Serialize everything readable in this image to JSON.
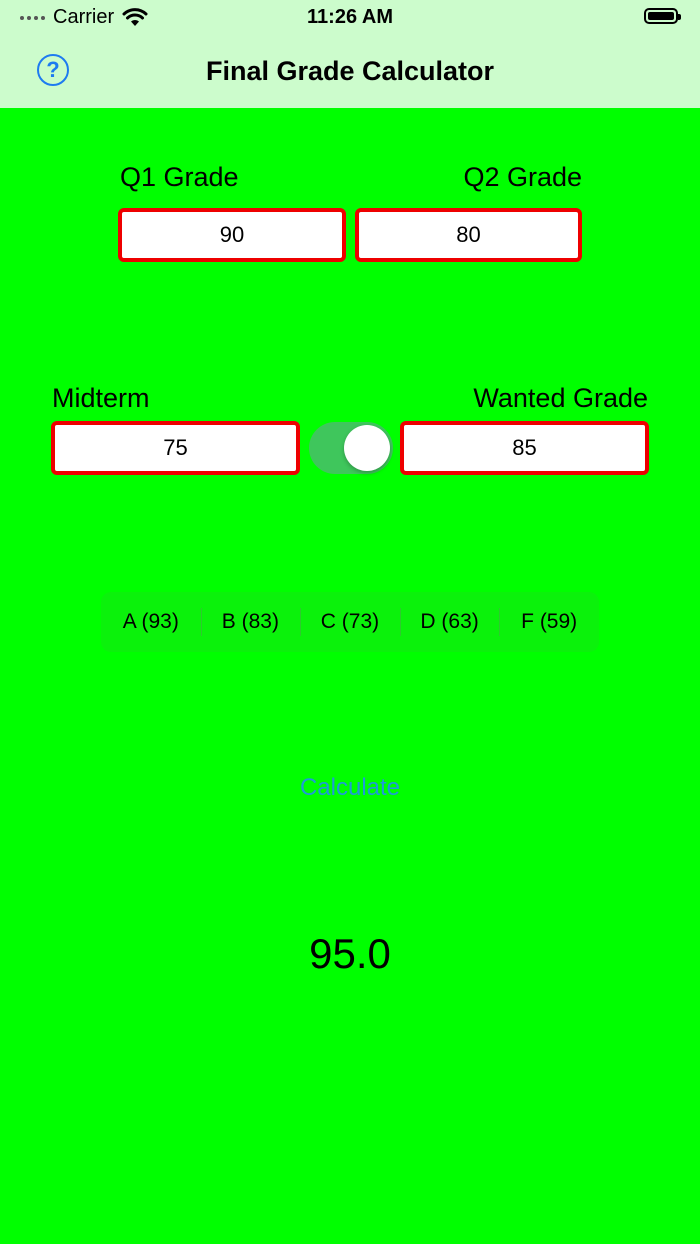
{
  "status_bar": {
    "carrier": "Carrier",
    "time": "11:26 AM"
  },
  "nav": {
    "title": "Final Grade Calculator",
    "help_label": "?"
  },
  "form": {
    "q1_label": "Q1 Grade",
    "q1_value": "90",
    "q2_label": "Q2 Grade",
    "q2_value": "80",
    "midterm_label": "Midterm",
    "midterm_value": "75",
    "wanted_label": "Wanted Grade",
    "wanted_value": "85",
    "toggle_on": true
  },
  "segments": [
    {
      "label": "A (93)"
    },
    {
      "label": "B (83)"
    },
    {
      "label": "C (73)"
    },
    {
      "label": "D (63)"
    },
    {
      "label": "F (59)"
    }
  ],
  "calculate_label": "Calculate",
  "result": "95.0",
  "colors": {
    "background": "#00ff00",
    "bar": "#ccfccc",
    "field_border": "#ee0000",
    "accent": "#1e7bf0"
  },
  "icons": {
    "wifi": "wifi-icon",
    "battery": "battery-icon",
    "help": "help-icon",
    "signal": "signal-icon"
  }
}
